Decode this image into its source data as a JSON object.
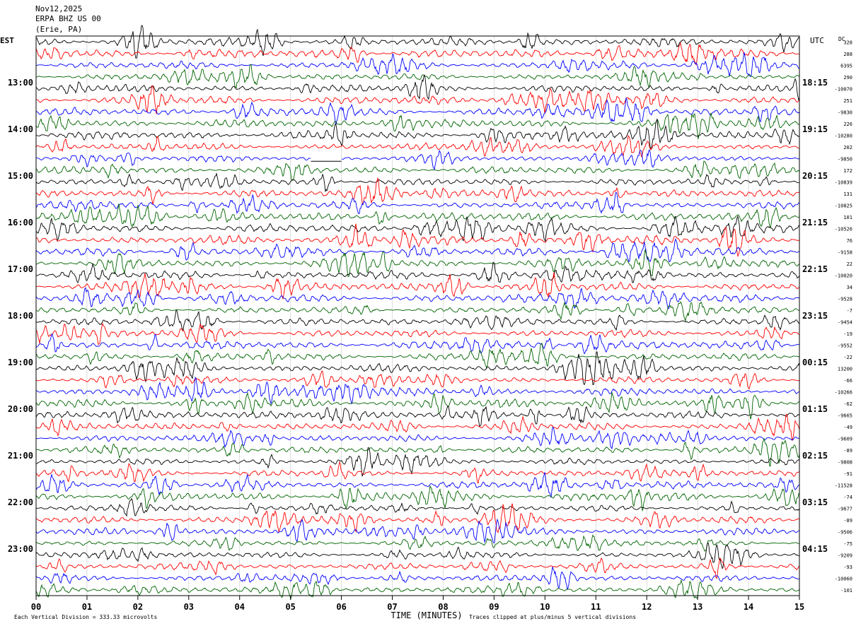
{
  "header": {
    "date": "Nov12,2025",
    "station": "ERPA BHZ US 00",
    "location": "(Erie, PA)",
    "left_zone": "EST",
    "right_zone": "UTC",
    "dc_label": "DC"
  },
  "footer": {
    "xlabel": "TIME (MINUTES)",
    "scale_note": "Each Vertical Division =  333.33 microvolts",
    "clip_note": "Traces clipped at plus/minus 5 vertical divisions"
  },
  "chart_data": {
    "type": "line",
    "title": "ERPA BHZ US 00",
    "xlabel": "TIME (MINUTES)",
    "ylabel": "",
    "xlim": [
      0,
      15
    ],
    "x_ticks": [
      "00",
      "01",
      "02",
      "03",
      "04",
      "05",
      "06",
      "07",
      "08",
      "09",
      "10",
      "11",
      "12",
      "13",
      "14",
      "15"
    ],
    "trace_count": 48,
    "trace_minutes": 15,
    "colors": [
      "#000000",
      "#ff0000",
      "#0000ff",
      "#006400"
    ],
    "left_hour_labels": [
      "13:00",
      "14:00",
      "15:00",
      "16:00",
      "17:00",
      "18:00",
      "19:00",
      "20:00",
      "21:00",
      "22:00",
      "23:00"
    ],
    "right_hour_labels": [
      "18:15",
      "19:15",
      "20:15",
      "21:15",
      "22:15",
      "23:15",
      "00:15",
      "01:15",
      "02:15",
      "03:15",
      "04:15"
    ],
    "dc_offsets": [
      "328",
      "288",
      "6395",
      "290",
      "-10070",
      "251",
      "-9830",
      "226",
      "-10280",
      "202",
      "-9850",
      "172",
      "-10839",
      "131",
      "-10825",
      "101",
      "-10526",
      "76",
      "-9158",
      "22",
      "-10020",
      "34",
      "-9528",
      "-7",
      "-9454",
      "-19",
      "-9552",
      "-22",
      "13200",
      "-66",
      "-10266",
      "-62",
      "-9665",
      "-49",
      "-9609",
      "-89",
      "-9808",
      "-91",
      "-11528",
      "-74",
      "-9677",
      "-89",
      "-9506",
      "-75",
      "-9209",
      "-93",
      "-10060",
      "-101"
    ],
    "gap": {
      "trace_index": 10,
      "start_minute": 5.4,
      "end_minute": 6.0
    }
  }
}
